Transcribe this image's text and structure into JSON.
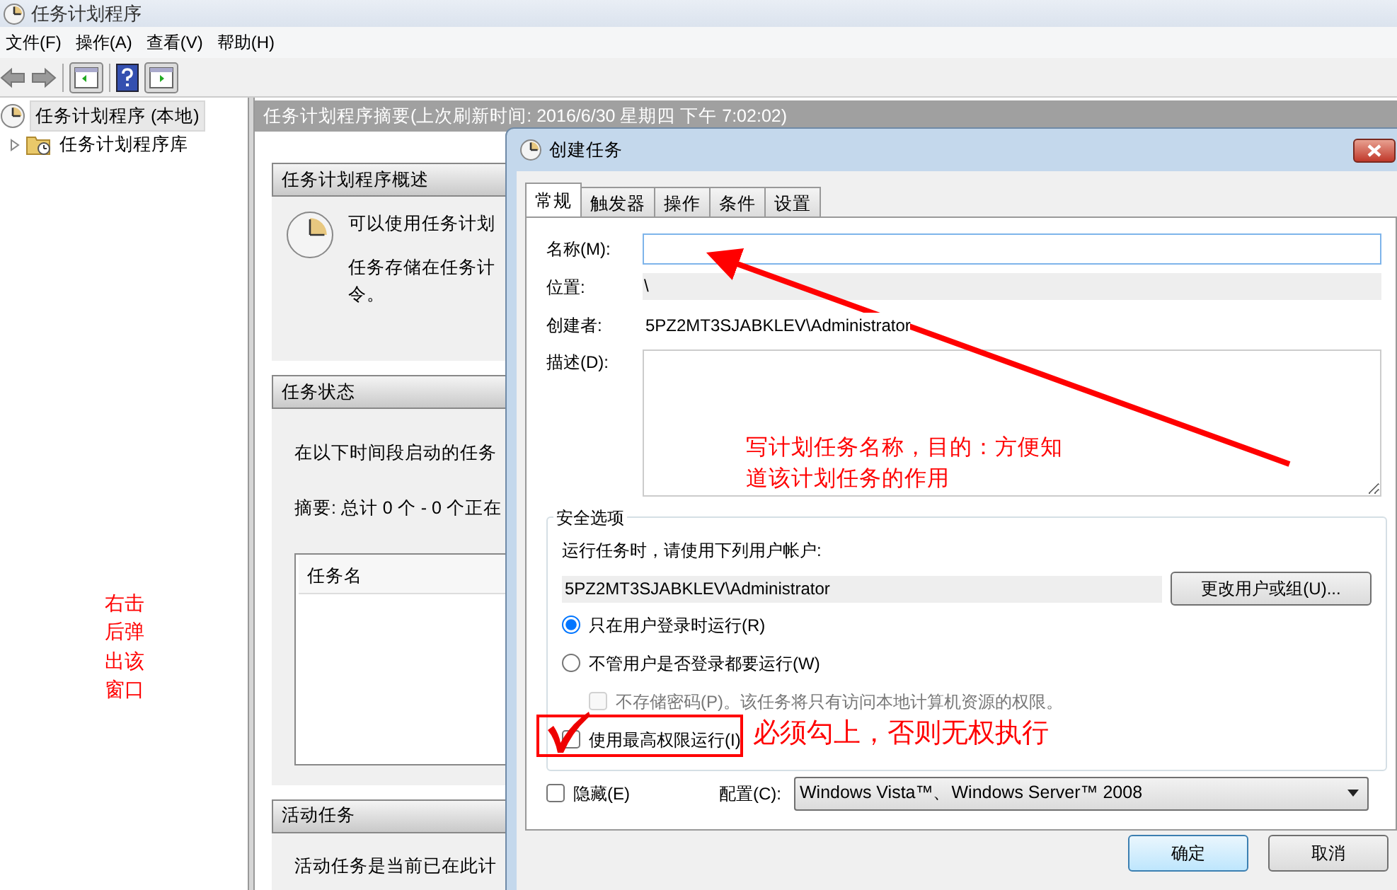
{
  "window": {
    "title": "任务计划程序"
  },
  "menu": [
    "文件(F)",
    "操作(A)",
    "查看(V)",
    "帮助(H)"
  ],
  "tree": [
    {
      "label": "任务计划程序 (本地)",
      "selected": true,
      "children": [
        {
          "label": "任务计划程序库",
          "selected": false,
          "expanded": false
        }
      ]
    }
  ],
  "left_note": "右击后弹出该窗口",
  "summary": {
    "header": "任务计划程序摘要(上次刷新时间: 2016/6/30 星期四 下午 7:02:02)",
    "sections": [
      {
        "kind": "overview",
        "title": "任务计划程序概述",
        "paragraphs": [
          "可以使用任务计划",
          "任务存储在任务计",
          "令。"
        ]
      },
      {
        "kind": "status",
        "title": "任务状态",
        "paragraphs": [
          "在以下时间段启动的任务",
          "摘要: 总计 0 个 - 0 个正在"
        ],
        "table": {
          "columns": [
            "任务名"
          ]
        }
      },
      {
        "kind": "plain",
        "title": "活动任务",
        "paragraphs": [
          "活动任务是当前已在此计"
        ]
      }
    ]
  },
  "dialog": {
    "title": "创建任务",
    "tabs": [
      {
        "label": "常规",
        "selected": true
      },
      {
        "label": "触发器",
        "selected": false
      },
      {
        "label": "操作",
        "selected": false
      },
      {
        "label": "条件",
        "selected": false
      },
      {
        "label": "设置",
        "selected": false
      }
    ],
    "fields": [
      {
        "kind": "input",
        "label": "名称(M):"
      },
      {
        "kind": "readonly",
        "label": "位置:",
        "value": "\\"
      },
      {
        "kind": "text",
        "label": "创建者:",
        "value": "5PZ2MT3SJABKLEV\\Administrator"
      },
      {
        "kind": "textarea",
        "label": "描述(D):"
      }
    ],
    "security": {
      "title": "安全选项",
      "prompt": "运行任务时，请使用下列用户帐户:",
      "account": "5PZ2MT3SJABKLEV\\Administrator",
      "change_button": "更改用户或组(U)...",
      "options": [
        {
          "kind": "radio",
          "label": "只在用户登录时运行(R)",
          "selected": true
        },
        {
          "kind": "radio",
          "label": "不管用户是否登录都要运行(W)",
          "selected": false,
          "children": [
            {
              "kind": "checkbox",
              "label": "不存储密码(P)。该任务将只有访问本地计算机资源的权限。",
              "checked": false,
              "disabled": true
            }
          ]
        },
        {
          "kind": "checkbox",
          "label": "使用最高权限运行(I)",
          "checked": false,
          "disabled": false
        }
      ]
    },
    "hidden": {
      "label": "隐藏(E)",
      "checked": false
    },
    "config": {
      "label": "配置(C):",
      "value": "Windows Vista™、Windows Server™ 2008"
    },
    "buttons": [
      "确定",
      "取消"
    ]
  },
  "annotations": {
    "name_note": "写计划任务名称，目的：方便知道该计划任务的作用",
    "admin_note": "必须勾上，否则无权执行"
  }
}
